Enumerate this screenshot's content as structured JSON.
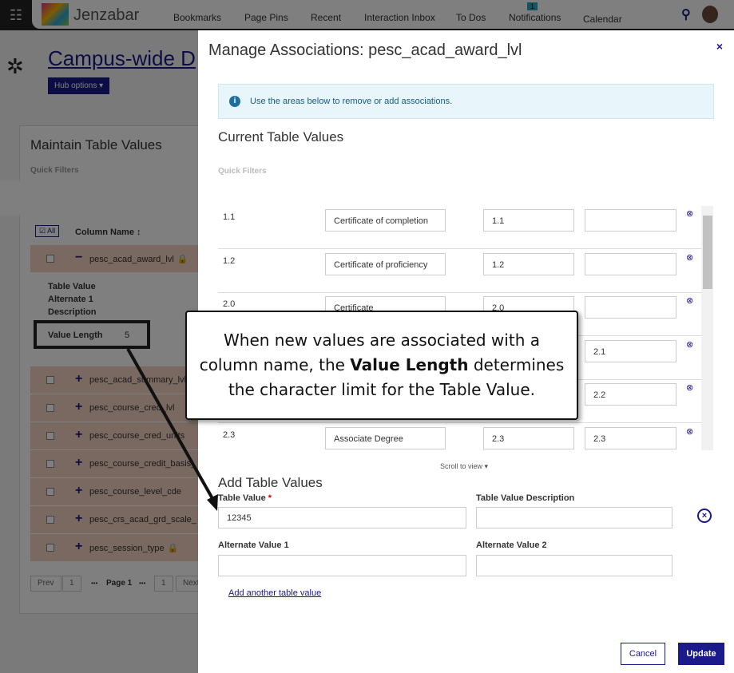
{
  "topbar": {
    "brand": "Jenzabar",
    "nav": [
      "Bookmarks",
      "Page Pins",
      "Recent",
      "Interaction Inbox",
      "To Dos",
      "Notifications",
      "Calendar"
    ],
    "notification_count": "1"
  },
  "page": {
    "title": "Campus-wide D",
    "hub_options": "Hub options ▾"
  },
  "panel": {
    "title": "Maintain Table Values",
    "quick_filters": "Quick Filters",
    "all_btn": "☑ All",
    "column_header": "Column Name ↕",
    "rows": [
      "pesc_acad_award_lvl",
      "pesc_acad_summary_lvl",
      "pesc_course_cred_lvl",
      "pesc_course_cred_units",
      "pesc_course_credit_basis_",
      "pesc_course_level_cde",
      "pesc_crs_acad_grd_scale_",
      "pesc_session_type"
    ],
    "details": [
      "Table Value",
      "Alternate 1",
      "Description"
    ],
    "value_length_label": "Value Length",
    "value_length": "5",
    "pager": {
      "prev": "Prev",
      "p1": "1",
      "dots": "•••",
      "page": "Page 1",
      "p1b": "1",
      "next": "Next"
    }
  },
  "modal": {
    "title": "Manage Associations: pesc_acad_award_lvl",
    "close": "×",
    "info": "Use the areas below to remove or add associations.",
    "current_title": "Current Table Values",
    "quick_filters": "Quick Filters",
    "rows": [
      {
        "value": "1.1",
        "desc": "Certificate of completion",
        "alt1": "1.1",
        "alt2": ""
      },
      {
        "value": "1.2",
        "desc": "Certificate of proficiency",
        "alt1": "1.2",
        "alt2": ""
      },
      {
        "value": "2.0",
        "desc": "Certificate",
        "alt1": "2.0",
        "alt2": ""
      },
      {
        "value": "",
        "desc": "",
        "alt1": "",
        "alt2": "2.1"
      },
      {
        "value": "",
        "desc": "",
        "alt1": "",
        "alt2": "2.2"
      },
      {
        "value": "2.3",
        "desc": "Associate Degree",
        "alt1": "2.3",
        "alt2": "2.3"
      }
    ],
    "scroll_to_view": "Scroll to view ▾",
    "add_title": "Add Table Values",
    "form": {
      "table_value_label": "Table Value",
      "required": "*",
      "table_value": "12345",
      "desc_label": "Table Value Description",
      "alt1_label": "Alternate Value 1",
      "alt2_label": "Alternate Value 2",
      "desc": "",
      "alt1": "",
      "alt2": ""
    },
    "add_another": "Add another table value",
    "cancel": "Cancel",
    "update": "Update"
  },
  "callout": {
    "pre": "When new values are associated with a column name, the ",
    "bold": "Value Length",
    "post": " determines the character limit for the Table Value."
  }
}
